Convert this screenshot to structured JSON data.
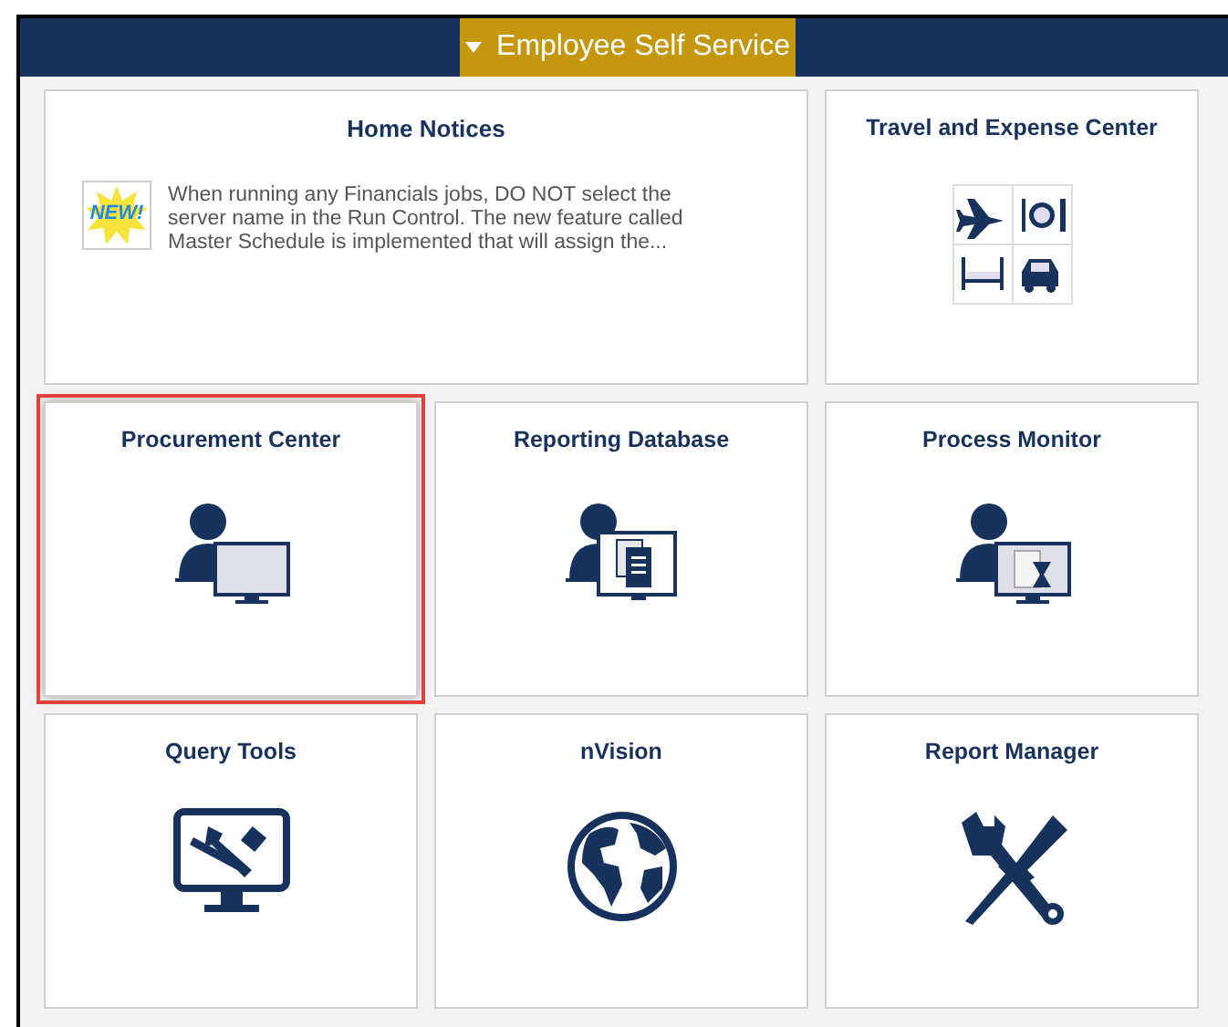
{
  "header": {
    "menu_label": "Employee Self Service"
  },
  "tiles": [
    {
      "kind": "notice",
      "title": "Home Notices",
      "badge": "NEW!",
      "text": "When running any Financials jobs, DO NOT select the server name in the Run Control. The new feature called Master Schedule is implemented that will assign the...",
      "selected": false
    },
    {
      "kind": "icon",
      "title": "Travel and Expense Center",
      "selected": false
    },
    {
      "kind": "icon",
      "title": "Procurement Center",
      "selected": true
    },
    {
      "kind": "icon",
      "title": "Reporting Database",
      "selected": false
    },
    {
      "kind": "icon",
      "title": "Process Monitor",
      "selected": false
    },
    {
      "kind": "icon",
      "title": "Query Tools",
      "selected": false
    },
    {
      "kind": "icon",
      "title": "nVision",
      "selected": false
    },
    {
      "kind": "icon",
      "title": "Report Manager",
      "selected": false
    }
  ]
}
